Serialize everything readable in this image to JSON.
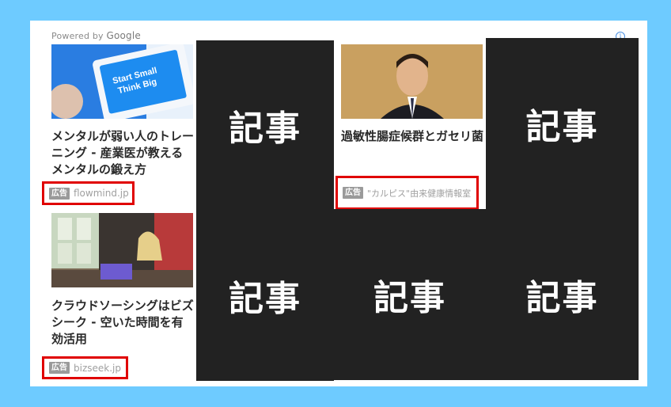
{
  "powered_by": {
    "prefix": "Powered by",
    "brand": "Google"
  },
  "info_icon": "info-icon",
  "cards": [
    {
      "title": "メンタルが弱い人のトレーニング - 産業医が教えるメンタルの鍛え方",
      "badge": "広告",
      "domain": "flowmind.jp",
      "image_text": "Start Small Think Big"
    },
    {
      "title": "過敏性腸症候群とガセリ菌",
      "badge": "広告",
      "domain": "\"カルピス\"由来健康情報室"
    },
    {
      "title": "クラウドソーシングはビズシーク - 空いた時間を有効活用",
      "badge": "広告",
      "domain": "bizseek.jp"
    }
  ],
  "article_placeholders": [
    "記事",
    "記事",
    "記事",
    "記事",
    "記事"
  ],
  "colors": {
    "background": "#6ecbff",
    "panel": "#ffffff",
    "dark_block": "#222222",
    "highlight": "#e00000"
  }
}
